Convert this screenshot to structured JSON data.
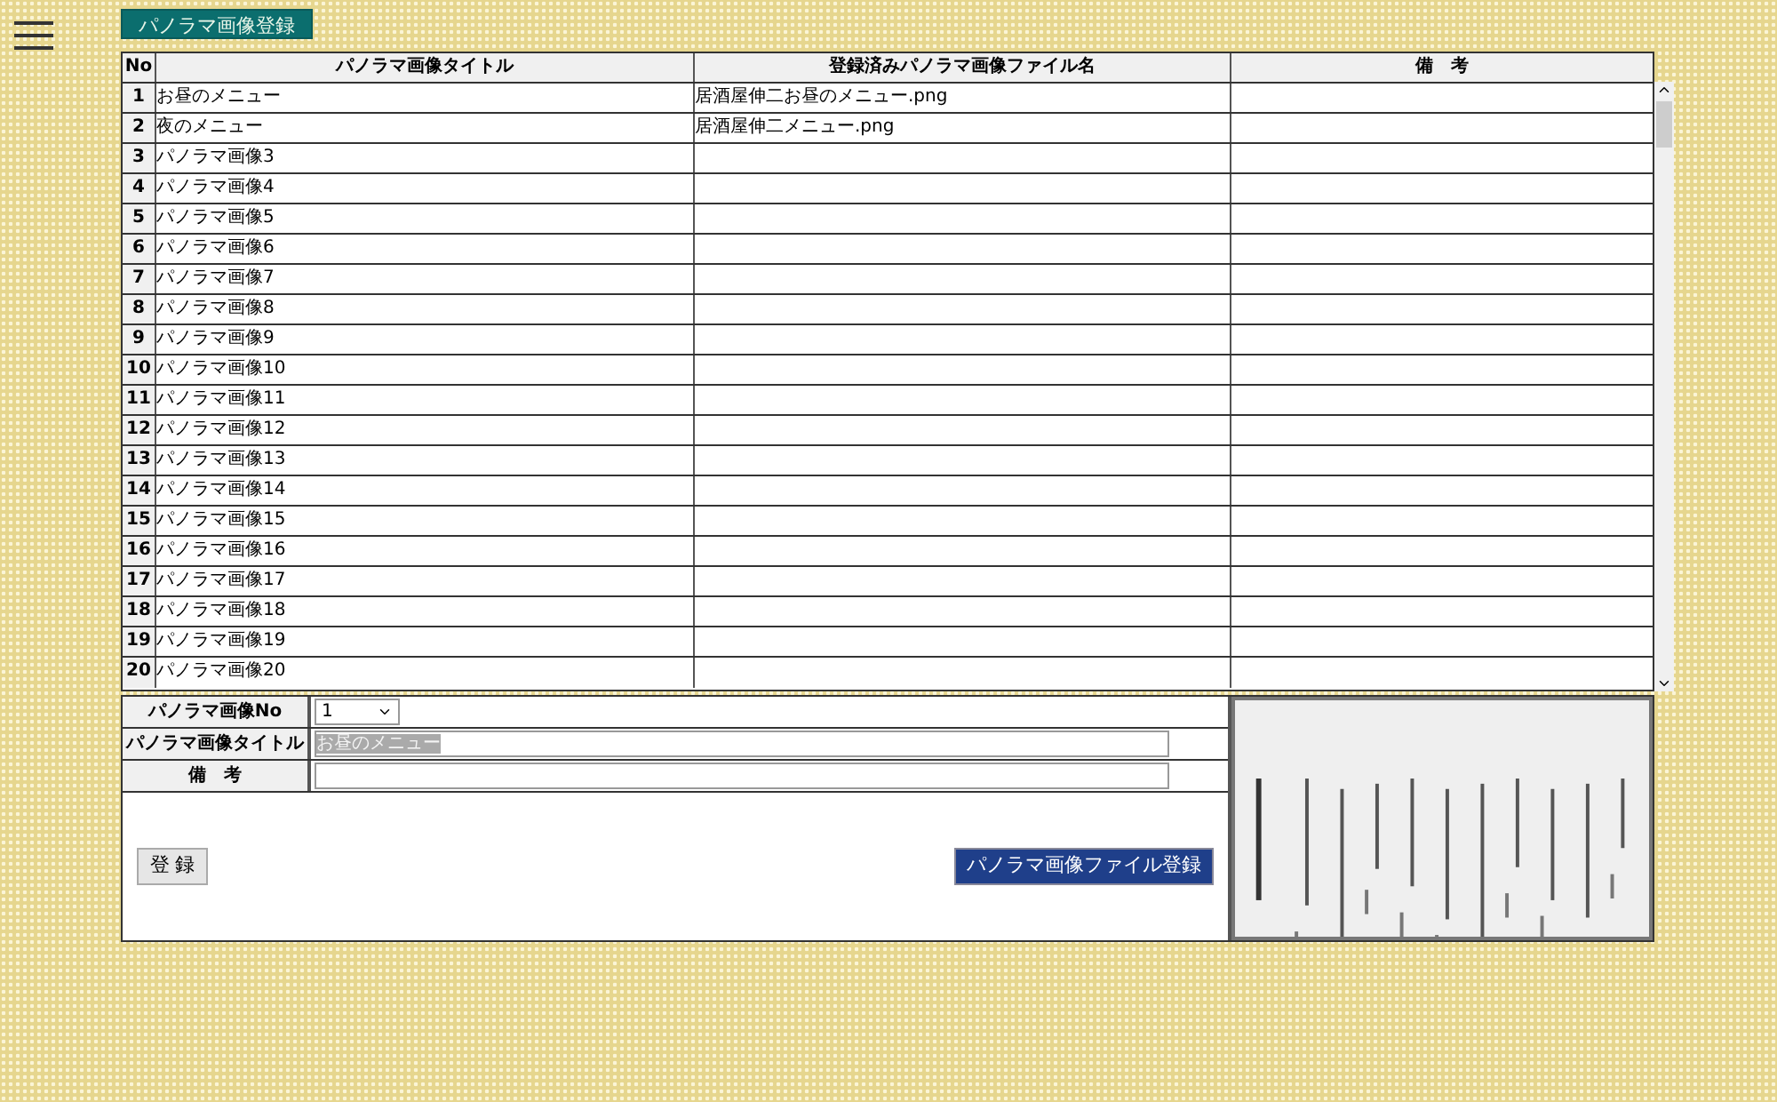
{
  "page_title": "パノラマ画像登録",
  "table": {
    "columns": [
      "No",
      "パノラマ画像タイトル",
      "登録済みパノラマ画像ファイル名",
      "備　考"
    ],
    "rows": [
      [
        "1",
        "お昼のメニュー",
        "居酒屋伸二お昼のメニュー.png",
        ""
      ],
      [
        "2",
        "夜のメニュー",
        "居酒屋伸二メニュー.png",
        ""
      ],
      [
        "3",
        "パノラマ画像3",
        "",
        ""
      ],
      [
        "4",
        "パノラマ画像4",
        "",
        ""
      ],
      [
        "5",
        "パノラマ画像5",
        "",
        ""
      ],
      [
        "6",
        "パノラマ画像6",
        "",
        ""
      ],
      [
        "7",
        "パノラマ画像7",
        "",
        ""
      ],
      [
        "8",
        "パノラマ画像8",
        "",
        ""
      ],
      [
        "9",
        "パノラマ画像9",
        "",
        ""
      ],
      [
        "10",
        "パノラマ画像10",
        "",
        ""
      ],
      [
        "11",
        "パノラマ画像11",
        "",
        ""
      ],
      [
        "12",
        "パノラマ画像12",
        "",
        ""
      ],
      [
        "13",
        "パノラマ画像13",
        "",
        ""
      ],
      [
        "14",
        "パノラマ画像14",
        "",
        ""
      ],
      [
        "15",
        "パノラマ画像15",
        "",
        ""
      ],
      [
        "16",
        "パノラマ画像16",
        "",
        ""
      ],
      [
        "17",
        "パノラマ画像17",
        "",
        ""
      ],
      [
        "18",
        "パノラマ画像18",
        "",
        ""
      ],
      [
        "19",
        "パノラマ画像19",
        "",
        ""
      ],
      [
        "20",
        "パノラマ画像20",
        "",
        ""
      ]
    ]
  },
  "form": {
    "no_label": "パノラマ画像No",
    "no_value": "1",
    "title_label": "パノラマ画像タイトル",
    "title_value": "お昼のメニュー",
    "note_label": "備　考",
    "register_button": "登 録",
    "file_button": "パノラマ画像ファイル登録"
  }
}
